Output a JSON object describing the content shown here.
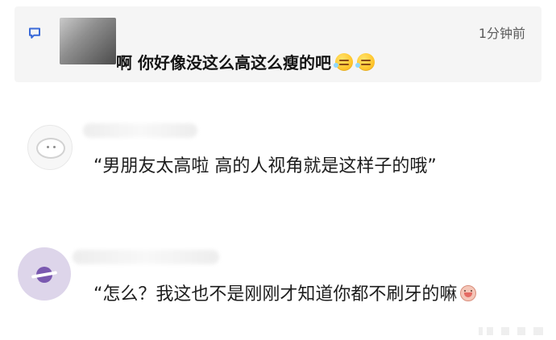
{
  "notification": {
    "time": "1分钟前",
    "text": "啊 你好像没这么高这么瘦的吧",
    "emoji_1": "laughing-tear-emoji",
    "emoji_2": "laughing-tear-emoji",
    "icon": "comment-icon"
  },
  "comments": [
    {
      "avatar_icon": "sheep-avatar",
      "name": "",
      "text": "“男朋友太高啦 高的人视角就是这样子的哦”"
    },
    {
      "avatar_icon": "planet-avatar",
      "name": "",
      "text": "“怎么？我这也不是刚刚才知道你都不刷牙的嘛",
      "emoji": "baby-emoji"
    }
  ],
  "colors": {
    "card_background": "#f5f5f5",
    "text_primary": "#1d1d1d",
    "timestamp": "#5b5b5b",
    "purple_avatar": "#ddd5ea"
  }
}
